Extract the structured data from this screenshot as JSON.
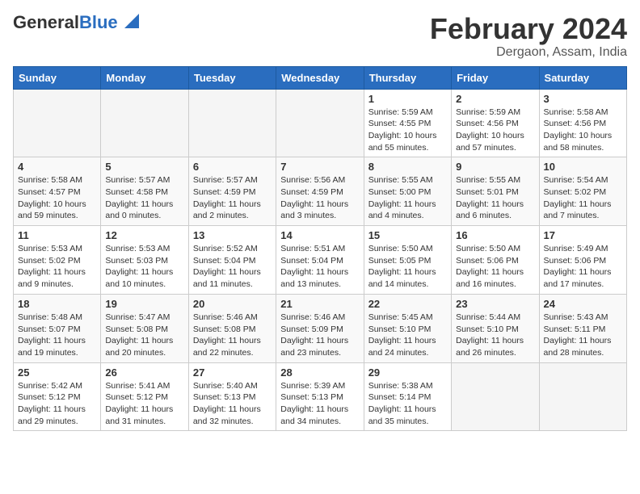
{
  "header": {
    "logo_general": "General",
    "logo_blue": "Blue",
    "month_year": "February 2024",
    "location": "Dergaon, Assam, India"
  },
  "days_of_week": [
    "Sunday",
    "Monday",
    "Tuesday",
    "Wednesday",
    "Thursday",
    "Friday",
    "Saturday"
  ],
  "weeks": [
    [
      {
        "day": "",
        "info": ""
      },
      {
        "day": "",
        "info": ""
      },
      {
        "day": "",
        "info": ""
      },
      {
        "day": "",
        "info": ""
      },
      {
        "day": "1",
        "info": "Sunrise: 5:59 AM\nSunset: 4:55 PM\nDaylight: 10 hours\nand 55 minutes."
      },
      {
        "day": "2",
        "info": "Sunrise: 5:59 AM\nSunset: 4:56 PM\nDaylight: 10 hours\nand 57 minutes."
      },
      {
        "day": "3",
        "info": "Sunrise: 5:58 AM\nSunset: 4:56 PM\nDaylight: 10 hours\nand 58 minutes."
      }
    ],
    [
      {
        "day": "4",
        "info": "Sunrise: 5:58 AM\nSunset: 4:57 PM\nDaylight: 10 hours\nand 59 minutes."
      },
      {
        "day": "5",
        "info": "Sunrise: 5:57 AM\nSunset: 4:58 PM\nDaylight: 11 hours\nand 0 minutes."
      },
      {
        "day": "6",
        "info": "Sunrise: 5:57 AM\nSunset: 4:59 PM\nDaylight: 11 hours\nand 2 minutes."
      },
      {
        "day": "7",
        "info": "Sunrise: 5:56 AM\nSunset: 4:59 PM\nDaylight: 11 hours\nand 3 minutes."
      },
      {
        "day": "8",
        "info": "Sunrise: 5:55 AM\nSunset: 5:00 PM\nDaylight: 11 hours\nand 4 minutes."
      },
      {
        "day": "9",
        "info": "Sunrise: 5:55 AM\nSunset: 5:01 PM\nDaylight: 11 hours\nand 6 minutes."
      },
      {
        "day": "10",
        "info": "Sunrise: 5:54 AM\nSunset: 5:02 PM\nDaylight: 11 hours\nand 7 minutes."
      }
    ],
    [
      {
        "day": "11",
        "info": "Sunrise: 5:53 AM\nSunset: 5:02 PM\nDaylight: 11 hours\nand 9 minutes."
      },
      {
        "day": "12",
        "info": "Sunrise: 5:53 AM\nSunset: 5:03 PM\nDaylight: 11 hours\nand 10 minutes."
      },
      {
        "day": "13",
        "info": "Sunrise: 5:52 AM\nSunset: 5:04 PM\nDaylight: 11 hours\nand 11 minutes."
      },
      {
        "day": "14",
        "info": "Sunrise: 5:51 AM\nSunset: 5:04 PM\nDaylight: 11 hours\nand 13 minutes."
      },
      {
        "day": "15",
        "info": "Sunrise: 5:50 AM\nSunset: 5:05 PM\nDaylight: 11 hours\nand 14 minutes."
      },
      {
        "day": "16",
        "info": "Sunrise: 5:50 AM\nSunset: 5:06 PM\nDaylight: 11 hours\nand 16 minutes."
      },
      {
        "day": "17",
        "info": "Sunrise: 5:49 AM\nSunset: 5:06 PM\nDaylight: 11 hours\nand 17 minutes."
      }
    ],
    [
      {
        "day": "18",
        "info": "Sunrise: 5:48 AM\nSunset: 5:07 PM\nDaylight: 11 hours\nand 19 minutes."
      },
      {
        "day": "19",
        "info": "Sunrise: 5:47 AM\nSunset: 5:08 PM\nDaylight: 11 hours\nand 20 minutes."
      },
      {
        "day": "20",
        "info": "Sunrise: 5:46 AM\nSunset: 5:08 PM\nDaylight: 11 hours\nand 22 minutes."
      },
      {
        "day": "21",
        "info": "Sunrise: 5:46 AM\nSunset: 5:09 PM\nDaylight: 11 hours\nand 23 minutes."
      },
      {
        "day": "22",
        "info": "Sunrise: 5:45 AM\nSunset: 5:10 PM\nDaylight: 11 hours\nand 24 minutes."
      },
      {
        "day": "23",
        "info": "Sunrise: 5:44 AM\nSunset: 5:10 PM\nDaylight: 11 hours\nand 26 minutes."
      },
      {
        "day": "24",
        "info": "Sunrise: 5:43 AM\nSunset: 5:11 PM\nDaylight: 11 hours\nand 28 minutes."
      }
    ],
    [
      {
        "day": "25",
        "info": "Sunrise: 5:42 AM\nSunset: 5:12 PM\nDaylight: 11 hours\nand 29 minutes."
      },
      {
        "day": "26",
        "info": "Sunrise: 5:41 AM\nSunset: 5:12 PM\nDaylight: 11 hours\nand 31 minutes."
      },
      {
        "day": "27",
        "info": "Sunrise: 5:40 AM\nSunset: 5:13 PM\nDaylight: 11 hours\nand 32 minutes."
      },
      {
        "day": "28",
        "info": "Sunrise: 5:39 AM\nSunset: 5:13 PM\nDaylight: 11 hours\nand 34 minutes."
      },
      {
        "day": "29",
        "info": "Sunrise: 5:38 AM\nSunset: 5:14 PM\nDaylight: 11 hours\nand 35 minutes."
      },
      {
        "day": "",
        "info": ""
      },
      {
        "day": "",
        "info": ""
      }
    ]
  ]
}
